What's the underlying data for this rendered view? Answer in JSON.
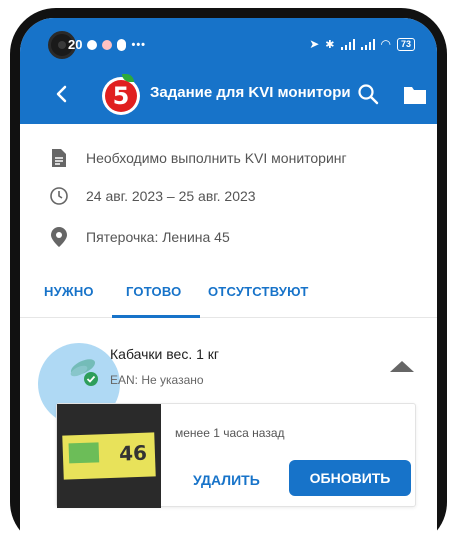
{
  "status_bar": {
    "time": "20",
    "battery": "73"
  },
  "app_bar": {
    "title": "Задание для KVI монитори"
  },
  "task": {
    "description": "Необходимо выполнить KVI мониторинг",
    "dates": "24 авг. 2023 – 25 авг. 2023",
    "store": "Пятерочка: Ленина 45"
  },
  "tabs": [
    {
      "label": "НУЖНО",
      "selected": false
    },
    {
      "label": "ГОТОВО",
      "selected": true
    },
    {
      "label": "ОТСУТСТВУЮТ",
      "selected": false
    }
  ],
  "item": {
    "name": "Кабачки вес. 1 кг",
    "ean": "EAN: Не указано",
    "photo_price": "46",
    "time_ago": "менее 1 часа назад",
    "delete_label": "УДАЛИТЬ",
    "update_label": "ОБНОВИТЬ"
  },
  "colors": {
    "primary": "#1773c9",
    "logo_red": "#e02020",
    "check_green": "#2e9e5a"
  }
}
